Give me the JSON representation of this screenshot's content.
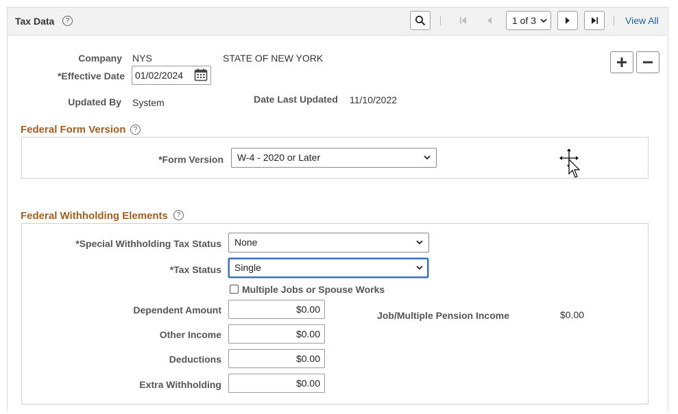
{
  "header": {
    "title": "Tax Data",
    "help_icon": "?",
    "pagination": "1 of 3",
    "view_all": "View All"
  },
  "company": {
    "label": "Company",
    "code": "NYS",
    "name": "STATE OF NEW YORK"
  },
  "effective_date": {
    "label": "*Effective Date",
    "value": "01/02/2024"
  },
  "updated_by": {
    "label": "Updated By",
    "value": "System"
  },
  "date_last_updated": {
    "label": "Date Last Updated",
    "value": "11/10/2022"
  },
  "federal_form_version": {
    "title": "Federal Form Version",
    "form_version_label": "*Form Version",
    "form_version_value": "W-4 - 2020 or Later"
  },
  "federal_withholding": {
    "title": "Federal Withholding Elements",
    "special_status_label": "*Special Withholding Tax Status",
    "special_status_value": "None",
    "tax_status_label": "*Tax Status",
    "tax_status_value": "Single",
    "multiple_jobs_label": "Multiple Jobs or Spouse Works",
    "multiple_jobs_checked": false,
    "dependent_amount_label": "Dependent Amount",
    "dependent_amount_value": "$0.00",
    "other_income_label": "Other Income",
    "other_income_value": "$0.00",
    "deductions_label": "Deductions",
    "deductions_value": "$0.00",
    "extra_withholding_label": "Extra Withholding",
    "extra_withholding_value": "$0.00",
    "job_pension_label": "Job/Multiple Pension Income",
    "job_pension_value": "$0.00"
  },
  "colors": {
    "section_title": "#a35d1e",
    "link": "#1f5f9e",
    "focus": "#3b6fb6"
  }
}
